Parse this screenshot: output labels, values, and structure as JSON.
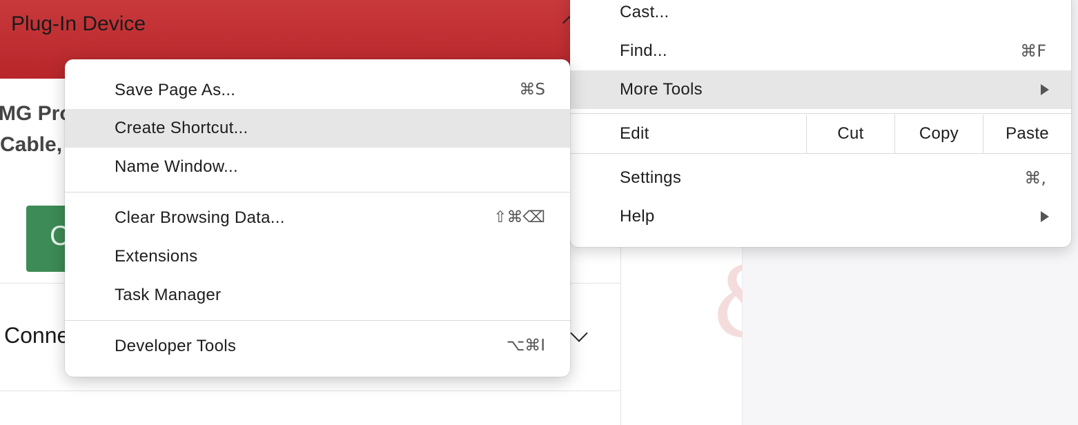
{
  "page": {
    "header_title": "Plug-In Device",
    "product_line1": "MG Pro",
    "product_line2": "Cable,",
    "button_partial": "C",
    "section_partial": "Conne"
  },
  "main_menu": {
    "items_top": [
      {
        "label": "Cast...",
        "shortcut": ""
      },
      {
        "label": "Find...",
        "shortcut": "⌘F"
      },
      {
        "label": "More Tools",
        "shortcut": "",
        "submenu": true,
        "highlighted": true
      }
    ],
    "edit": {
      "label": "Edit",
      "cut": "Cut",
      "copy": "Copy",
      "paste": "Paste"
    },
    "items_bottom": [
      {
        "label": "Settings",
        "shortcut": "⌘,"
      },
      {
        "label": "Help",
        "shortcut": "",
        "submenu": true
      }
    ]
  },
  "more_tools_menu": {
    "save_page": {
      "label": "Save Page As...",
      "shortcut": "⌘S"
    },
    "create_shortcut": {
      "label": "Create Shortcut...",
      "shortcut": "",
      "highlighted": true
    },
    "name_window": {
      "label": "Name Window...",
      "shortcut": ""
    },
    "clear_data": {
      "label": "Clear Browsing Data...",
      "shortcut": "⇧⌘⌫"
    },
    "extensions": {
      "label": "Extensions",
      "shortcut": ""
    },
    "task_manager": {
      "label": "Task Manager",
      "shortcut": ""
    },
    "dev_tools": {
      "label": "Developer Tools",
      "shortcut": "⌥⌘I"
    }
  },
  "colors": {
    "header_red": "#c0303a",
    "button_green": "#3d8b56",
    "menu_highlight": "#e6e6e6"
  }
}
